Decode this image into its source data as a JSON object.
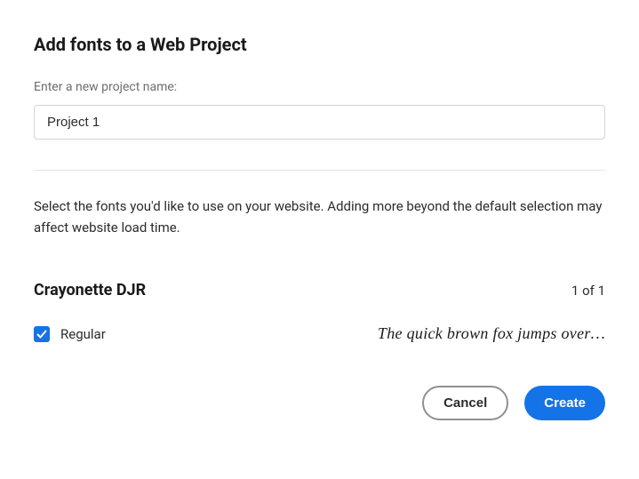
{
  "dialog": {
    "title": "Add fonts to a Web Project"
  },
  "project_name": {
    "label": "Enter a new project name:",
    "value": "Project 1"
  },
  "description": "Select the fonts you'd like to use on your website. Adding more beyond the default selection may affect website load time.",
  "font_family": {
    "name": "Crayonette DJR",
    "count_text": "1 of 1",
    "variants": [
      {
        "label": "Regular",
        "checked": true,
        "sample": "The quick brown fox jumps over…"
      }
    ]
  },
  "buttons": {
    "cancel": "Cancel",
    "create": "Create"
  }
}
